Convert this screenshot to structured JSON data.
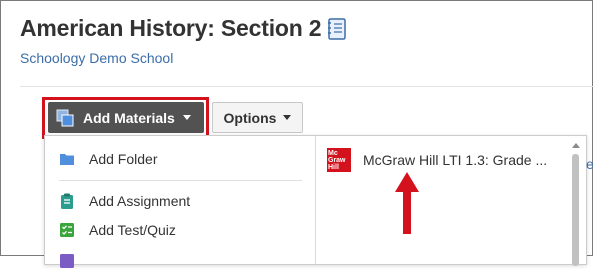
{
  "course": {
    "title": "American History: Section 2",
    "school": "Schoology Demo School"
  },
  "toolbar": {
    "add_materials_label": "Add Materials",
    "options_label": "Options"
  },
  "add_menu": {
    "items": [
      {
        "label": "Add Folder",
        "icon": "folder-icon"
      },
      {
        "label": "Add Assignment",
        "icon": "assignment-icon"
      },
      {
        "label": "Add Test/Quiz",
        "icon": "test-quiz-icon"
      }
    ],
    "lti_tool": {
      "label": "McGraw Hill LTI 1.3: Grade ...",
      "logo_text": [
        "Mc",
        "Graw",
        "Hill"
      ],
      "icon": "mcgraw-hill-logo"
    }
  },
  "edge_text": "e",
  "colors": {
    "accent_red": "#d4121e",
    "link_blue": "#3b6da8",
    "button_dark": "#525252",
    "folder_blue": "#4f8fde",
    "assignment_teal": "#2a9d8f",
    "quiz_green": "#3aa53c"
  }
}
